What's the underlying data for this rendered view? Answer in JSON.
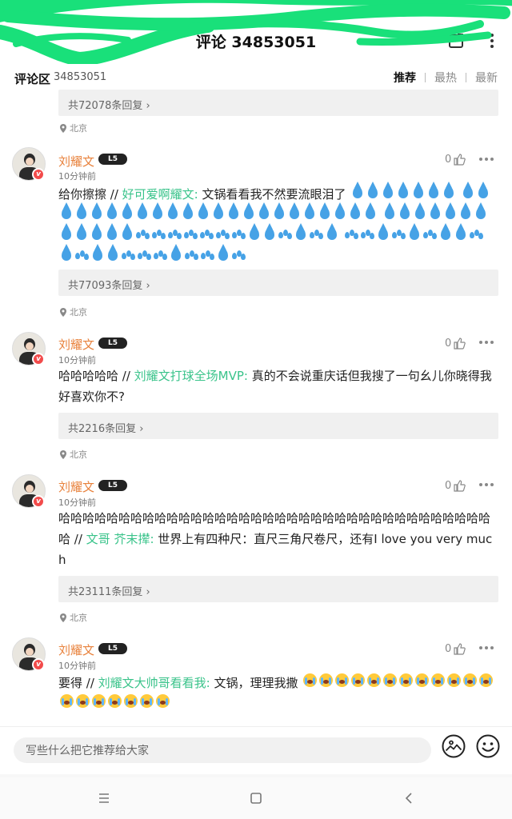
{
  "header": {
    "title": "评论 34853051"
  },
  "tabbar": {
    "label": "评论区",
    "count": "34853051",
    "sorts": [
      "推荐",
      "最热",
      "最新"
    ]
  },
  "top": {
    "replies": "共72078条回复",
    "location": "北京"
  },
  "comments": [
    {
      "user": "刘耀文",
      "level": "5",
      "time": "10分钟前",
      "likes": "0",
      "prefix": "给你擦擦",
      "sep": " // ",
      "mention": "好可爱啊耀文:",
      "body": " 文锅看看我不然要流眼泪了",
      "emoji": "sweat-drops-icon",
      "replies": "共77093条回复",
      "location": "北京"
    },
    {
      "user": "刘耀文",
      "level": "5",
      "time": "10分钟前",
      "likes": "0",
      "prefix": "哈哈哈哈哈",
      "sep": " // ",
      "mention": "刘耀文打球全场MVP:",
      "body": " 真的不会说重庆话但我搜了一句幺儿你晓得我好喜欢你不?",
      "replies": "共2216条回复",
      "location": "北京"
    },
    {
      "user": "刘耀文",
      "level": "5",
      "time": "10分钟前",
      "likes": "0",
      "prefix": "哈哈哈哈哈哈哈哈哈哈哈哈哈哈哈哈哈哈哈哈哈哈哈哈哈哈哈哈哈哈哈哈哈哈哈哈哈",
      "sep": " // ",
      "mention": "文哥 芥末撵:",
      "body": " 世界上有四种尺：直尺三角尺卷尺，还有I love you very much",
      "replies": "共23111条回复",
      "location": "北京"
    },
    {
      "user": "刘耀文",
      "level": "5",
      "time": "10分钟前",
      "likes": "0",
      "prefix": "要得",
      "sep": " // ",
      "mention": "刘耀文大帅哥看看我:",
      "body": " 文锅，理理我撒",
      "emoji": "crying-face-icon"
    }
  ],
  "input": {
    "placeholder": "写些什么把它推荐给大家"
  },
  "colors": {
    "accent": "#39c38a",
    "username": "#e8813b",
    "badge": "#f24b4b",
    "scribble": "#19e07a"
  }
}
